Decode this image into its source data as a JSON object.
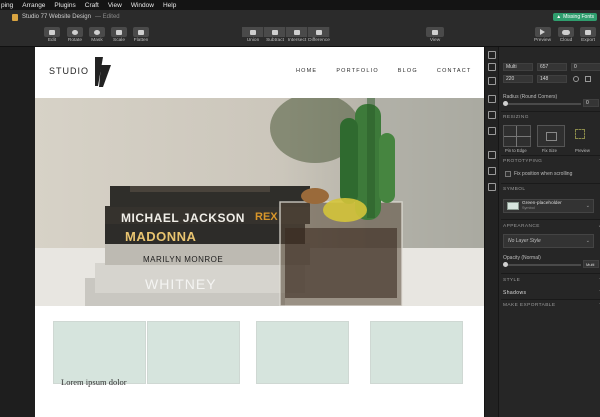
{
  "menu": [
    "ping",
    "Arrange",
    "Plugins",
    "Craft",
    "View",
    "Window",
    "Help"
  ],
  "window": {
    "title": "Studio 77 Website Design",
    "edited": "— Edited",
    "missing_fonts": "Missing Fonts"
  },
  "toolbar": {
    "edit": "Edit",
    "rotate": "Rotate",
    "mask": "Mask",
    "scale": "Scale",
    "flatten": "Flatten",
    "union": "Union",
    "subtract": "Subtract",
    "intersect": "Intersect",
    "difference": "Difference",
    "view": "View",
    "preview": "Preview",
    "cloud": "Cloud",
    "export": "Export"
  },
  "site": {
    "logo_text": "STUDIO",
    "nav": [
      "HOME",
      "PORTFOLIO",
      "BLOG",
      "CONTACT"
    ],
    "book_labels": [
      "MICHAEL JACKSON",
      "MADONNA",
      "MARILYN MONROE",
      "WHITNEY"
    ],
    "book_label_partial": "REX",
    "caption": "Lorem ipsum dolor"
  },
  "inspector": {
    "multi": "Multi",
    "x": "657",
    "y": "0",
    "w": "220",
    "h": "148",
    "radius_label": "Radius (Round Corners)",
    "radius_value": "0",
    "resizing": "RESIZING",
    "pin_to_edge": "Pin to Edge",
    "fix_size": "Fix Size",
    "preview": "Preview",
    "prototyping": "PROTOTYPING",
    "fix_position": "Fix position when scrolling",
    "symbol": "SYMBOL",
    "symbol_name": "Green-placeholder",
    "symbol_sub": "Symbol",
    "appearance": "APPEARANCE",
    "layer_style": "No Layer Style",
    "opacity_label": "Opacity (Normal)",
    "opacity_value": "Multi",
    "style": "STYLE",
    "shadows": "Shadows",
    "make_exportable": "MAKE EXPORTABLE"
  },
  "colors": {
    "placeholder": "#d6e4dd",
    "accent": "#2f9e6e",
    "cactus": "#3d7a3a"
  }
}
